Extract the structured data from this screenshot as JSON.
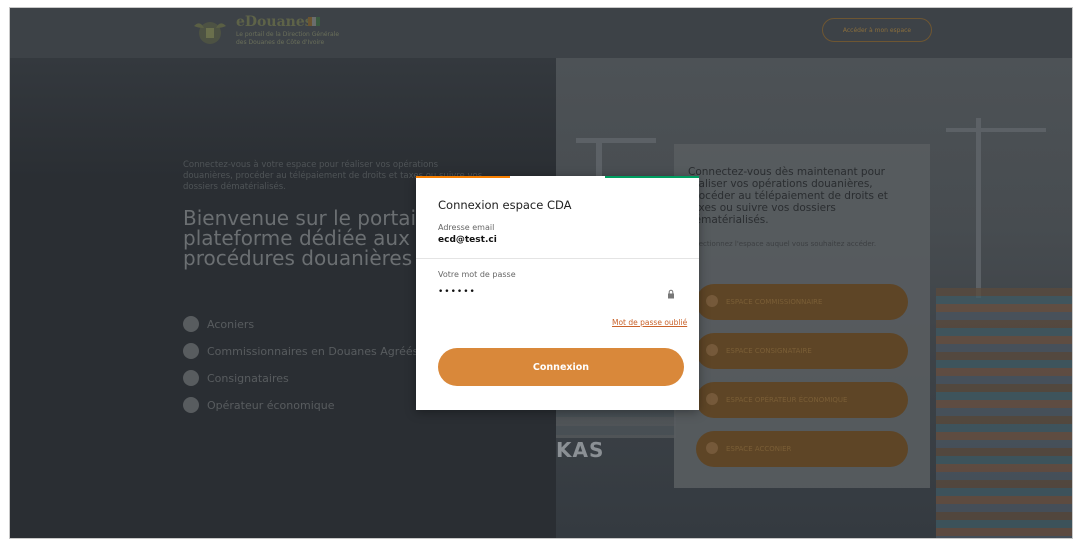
{
  "header": {
    "brand_title": "eDouanes",
    "brand_subtitle": "Le portail de la Direction Générale des Douanes de Côte d'Ivoire",
    "cta_label": "Accéder à mon espace"
  },
  "left": {
    "intro": "Connectez-vous à votre espace pour réaliser vos opérations douanières, procéder au télépaiement de droits et taxes ou suivre vos dossiers dématérialisés.",
    "welcome": "Bienvenue sur le portail eDouanes, la plateforme dédiée aux acteurs des procédures douanières :",
    "actors": [
      {
        "label": "Aconiers"
      },
      {
        "label": "Commissionnaires en Douanes Agréés"
      },
      {
        "label": "Consignataires"
      },
      {
        "label": "Opérateur économique"
      }
    ]
  },
  "card": {
    "text": "Connectez-vous dès maintenant pour réaliser vos opérations douanières, procéder au télépaiement de droits et taxes ou suivre vos dossiers dématérialisés.",
    "hint": "Sélectionnez l'espace auquel vous souhaitez accéder.",
    "buttons": [
      {
        "label": "ESPACE COMMISSIONNAIRE"
      },
      {
        "label": "ESPACE CONSIGNATAIRE"
      },
      {
        "label": "ESPACE OPÉRATEUR ÉCONOMIQUE"
      },
      {
        "label": "ESPACE ACCONIER"
      }
    ]
  },
  "photo": {
    "ship_text": "KAS"
  },
  "modal": {
    "title": "Connexion espace CDA",
    "email_label": "Adresse email",
    "email_value": "ecd@test.ci",
    "password_label": "Votre mot de passe",
    "password_value": "••••••",
    "forgot_label": "Mot de passe oublié",
    "submit_label": "Connexion",
    "icons": {
      "password": "lock-icon"
    }
  },
  "colors": {
    "accent": "#d9883a",
    "link": "#c9622a",
    "flag_orange": "#f77f00",
    "flag_white": "#ffffff",
    "flag_green": "#009e60"
  }
}
